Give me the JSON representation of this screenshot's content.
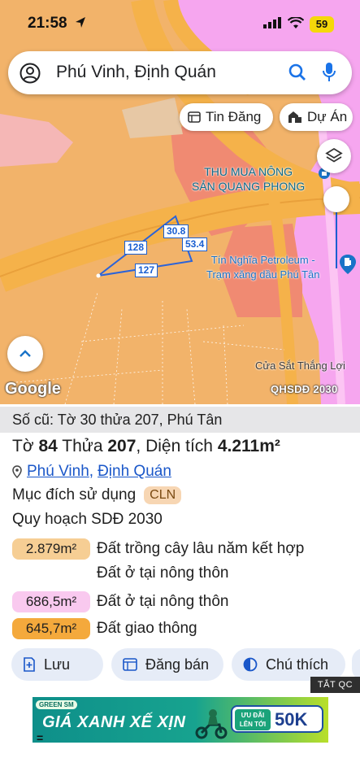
{
  "status_bar": {
    "time": "21:58",
    "battery": "59"
  },
  "search": {
    "query": "Phú Vinh, Định Quán"
  },
  "chips": {
    "tin_dang": "Tin Đăng",
    "du_an": "Dự Án"
  },
  "map": {
    "poi_thumua_line1": "THU MUA NÔNG",
    "poi_thumua_line2": "SẢN QUANG PHONG",
    "poi_petroleum_line1": "Tín Nghĩa Petroleum -",
    "poi_petroleum_line2": "Trạm xăng dầu Phú Tân",
    "poi_cua_sat": "Cửa Sắt Thắng Lợi",
    "dimensions": {
      "side_128": "128",
      "side_30_8": "30.8",
      "side_53_4": "53.4",
      "side_127": "127"
    },
    "google_logo": "Google",
    "layer_label": "QHSDĐ 2030"
  },
  "parcel": {
    "old_number": "Số cũ: Tờ 30 thửa 207, Phú Tân",
    "sheet_label": "Tờ",
    "sheet": "84",
    "plot_label": "Thửa",
    "plot": "207",
    "area_label": ", Diện tích",
    "area": "4.211m²",
    "commune": "Phú Vinh",
    "district": "Định Quán",
    "purpose_label": "Mục đích sử dụng",
    "purpose_code": "CLN",
    "plan_label": "Quy hoạch SDĐ 2030",
    "zones": [
      {
        "area": "2.879m²",
        "desc_line1": "Đất trồng cây lâu năm kết hợp",
        "desc_line2": "Đất ở tại nông thôn",
        "color": "#f6ce94"
      },
      {
        "area": "686,5m²",
        "desc_line1": "Đất ở tại nông thôn",
        "color": "#f9c9ef"
      },
      {
        "area": "645,7m²",
        "desc_line1": "Đất giao thông",
        "color": "#f4a93c"
      }
    ]
  },
  "actions": {
    "save": "Lưu",
    "post_sale": "Đăng bán",
    "legend": "Chú thích"
  },
  "ad": {
    "close_label": "TẮT QC",
    "brand": "GREEN SM",
    "slogan": "GIÁ XANH XẾ XỊN",
    "promo_label": "ƯU ĐÃI LÊN TỚI",
    "promo_value": "50K",
    "bottom_mark": "="
  },
  "colors": {
    "accent_blue": "#1a57c9",
    "map_orange": "#f2b36a",
    "map_pink": "#f6a6ef",
    "road_orange": "#f4a63a"
  }
}
